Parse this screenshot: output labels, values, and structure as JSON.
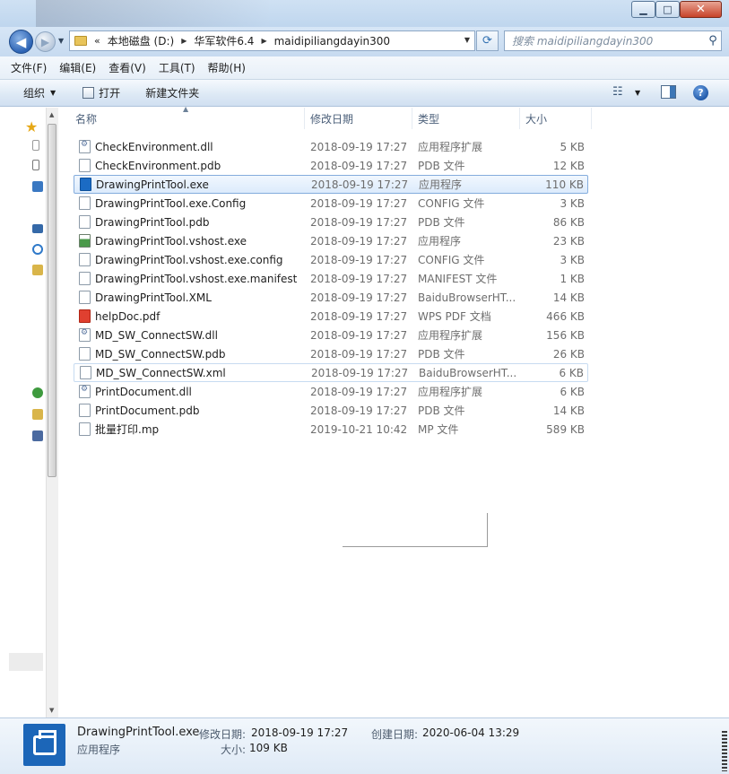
{
  "window": {
    "min_glyph": "▁",
    "max_glyph": "□",
    "close_glyph": "✕"
  },
  "address": {
    "overflow": "«",
    "crumbs": [
      "本地磁盘 (D:)",
      "华军软件6.4",
      "maidipiliangdayin300"
    ],
    "sep": "▶",
    "dropdown": "▼"
  },
  "search": {
    "placeholder": "搜索 maidipiliangdayin300"
  },
  "menu": [
    "文件(F)",
    "编辑(E)",
    "查看(V)",
    "工具(T)",
    "帮助(H)"
  ],
  "commands": {
    "organize": "组织",
    "open": "打开",
    "new_folder": "新建文件夹"
  },
  "columns": {
    "name": "名称",
    "date": "修改日期",
    "type": "类型",
    "size": "大小"
  },
  "files": [
    {
      "name": "CheckEnvironment.dll",
      "date": "2018-09-19 17:27",
      "type": "应用程序扩展",
      "size": "5 KB",
      "icon": "dll"
    },
    {
      "name": "CheckEnvironment.pdb",
      "date": "2018-09-19 17:27",
      "type": "PDB 文件",
      "size": "12 KB",
      "icon": "doc"
    },
    {
      "name": "DrawingPrintTool.exe",
      "date": "2018-09-19 17:27",
      "type": "应用程序",
      "size": "110 KB",
      "icon": "exe"
    },
    {
      "name": "DrawingPrintTool.exe.Config",
      "date": "2018-09-19 17:27",
      "type": "CONFIG 文件",
      "size": "3 KB",
      "icon": "doc"
    },
    {
      "name": "DrawingPrintTool.pdb",
      "date": "2018-09-19 17:27",
      "type": "PDB 文件",
      "size": "86 KB",
      "icon": "doc"
    },
    {
      "name": "DrawingPrintTool.vshost.exe",
      "date": "2018-09-19 17:27",
      "type": "应用程序",
      "size": "23 KB",
      "icon": "vshost"
    },
    {
      "name": "DrawingPrintTool.vshost.exe.config",
      "date": "2018-09-19 17:27",
      "type": "CONFIG 文件",
      "size": "3 KB",
      "icon": "doc"
    },
    {
      "name": "DrawingPrintTool.vshost.exe.manifest",
      "date": "2018-09-19 17:27",
      "type": "MANIFEST 文件",
      "size": "1 KB",
      "icon": "doc"
    },
    {
      "name": "DrawingPrintTool.XML",
      "date": "2018-09-19 17:27",
      "type": "BaiduBrowserHT...",
      "size": "14 KB",
      "icon": "doc"
    },
    {
      "name": "helpDoc.pdf",
      "date": "2018-09-19 17:27",
      "type": "WPS PDF 文档",
      "size": "466 KB",
      "icon": "pdf"
    },
    {
      "name": "MD_SW_ConnectSW.dll",
      "date": "2018-09-19 17:27",
      "type": "应用程序扩展",
      "size": "156 KB",
      "icon": "dll"
    },
    {
      "name": "MD_SW_ConnectSW.pdb",
      "date": "2018-09-19 17:27",
      "type": "PDB 文件",
      "size": "26 KB",
      "icon": "doc"
    },
    {
      "name": "MD_SW_ConnectSW.xml",
      "date": "2018-09-19 17:27",
      "type": "BaiduBrowserHT...",
      "size": "6 KB",
      "icon": "doc"
    },
    {
      "name": "PrintDocument.dll",
      "date": "2018-09-19 17:27",
      "type": "应用程序扩展",
      "size": "6 KB",
      "icon": "dll"
    },
    {
      "name": "PrintDocument.pdb",
      "date": "2018-09-19 17:27",
      "type": "PDB 文件",
      "size": "14 KB",
      "icon": "doc"
    },
    {
      "name": "批量打印.mp",
      "date": "2019-10-21 10:42",
      "type": "MP 文件",
      "size": "589 KB",
      "icon": "doc"
    }
  ],
  "selected_file": "DrawingPrintTool.exe",
  "hovered_file": "MD_SW_ConnectSW.xml",
  "details": {
    "name": "DrawingPrintTool.exe",
    "type": "应用程序",
    "modified_label": "修改日期:",
    "modified_value": "2018-09-19 17:27",
    "created_label": "创建日期:",
    "created_value": "2020-06-04 13:29",
    "size_label": "大小:",
    "size_value": "109 KB"
  },
  "colors": {
    "accent": "#1c66b8",
    "selection": "#dcebfc",
    "selection_border": "#84acdd"
  }
}
